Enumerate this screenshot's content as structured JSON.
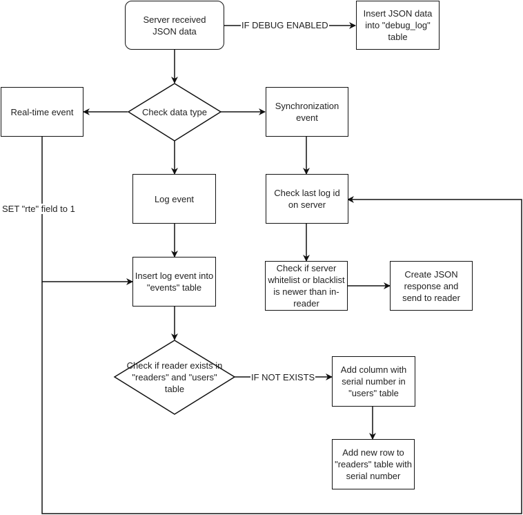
{
  "diagram": {
    "type": "flowchart",
    "nodes": {
      "start": {
        "label": "Server received JSON data",
        "shape": "rounded-rectangle"
      },
      "debug_insert": {
        "label": "Insert JSON data into \"debug_log\" table",
        "shape": "rectangle"
      },
      "check_type": {
        "label": "Check data type",
        "shape": "diamond"
      },
      "realtime": {
        "label": "Real-time event",
        "shape": "rectangle"
      },
      "sync": {
        "label": "Synchronization event",
        "shape": "rectangle"
      },
      "log_event": {
        "label": "Log event",
        "shape": "rectangle"
      },
      "check_last_log": {
        "label": "Check last log id on server",
        "shape": "rectangle"
      },
      "insert_events": {
        "label": "Insert log event into \"events\" table",
        "shape": "rectangle"
      },
      "check_lists": {
        "label": "Check if server whitelist or blacklist is newer than in-reader",
        "shape": "rectangle"
      },
      "create_response": {
        "label": "Create JSON response and send to reader",
        "shape": "rectangle"
      },
      "check_reader": {
        "label": "Check if reader exists in \"readers\" and \"users\" table",
        "shape": "diamond"
      },
      "add_column": {
        "label": "Add column with serial number in \"users\" table",
        "shape": "rectangle"
      },
      "add_row": {
        "label": "Add new row to \"readers\" table with serial number",
        "shape": "rectangle"
      }
    },
    "edge_labels": {
      "debug": "IF DEBUG ENABLED",
      "rte": "SET \"rte\" field to 1",
      "not_exists": "IF NOT EXISTS"
    },
    "edges": [
      {
        "from": "start",
        "to": "debug_insert",
        "label": "IF DEBUG ENABLED"
      },
      {
        "from": "start",
        "to": "check_type"
      },
      {
        "from": "check_type",
        "to": "realtime"
      },
      {
        "from": "check_type",
        "to": "sync"
      },
      {
        "from": "check_type",
        "to": "log_event"
      },
      {
        "from": "sync",
        "to": "check_last_log"
      },
      {
        "from": "log_event",
        "to": "insert_events"
      },
      {
        "from": "realtime",
        "to": "insert_events",
        "label": "SET \"rte\" field to 1"
      },
      {
        "from": "check_last_log",
        "to": "check_lists"
      },
      {
        "from": "check_lists",
        "to": "create_response"
      },
      {
        "from": "insert_events",
        "to": "check_reader"
      },
      {
        "from": "check_reader",
        "to": "add_column",
        "label": "IF NOT EXISTS"
      },
      {
        "from": "add_column",
        "to": "add_row"
      },
      {
        "from": "realtime",
        "to": "check_last_log"
      }
    ],
    "colors": {
      "stroke": "#111111",
      "fill": "#ffffff",
      "text": "#222222"
    }
  }
}
